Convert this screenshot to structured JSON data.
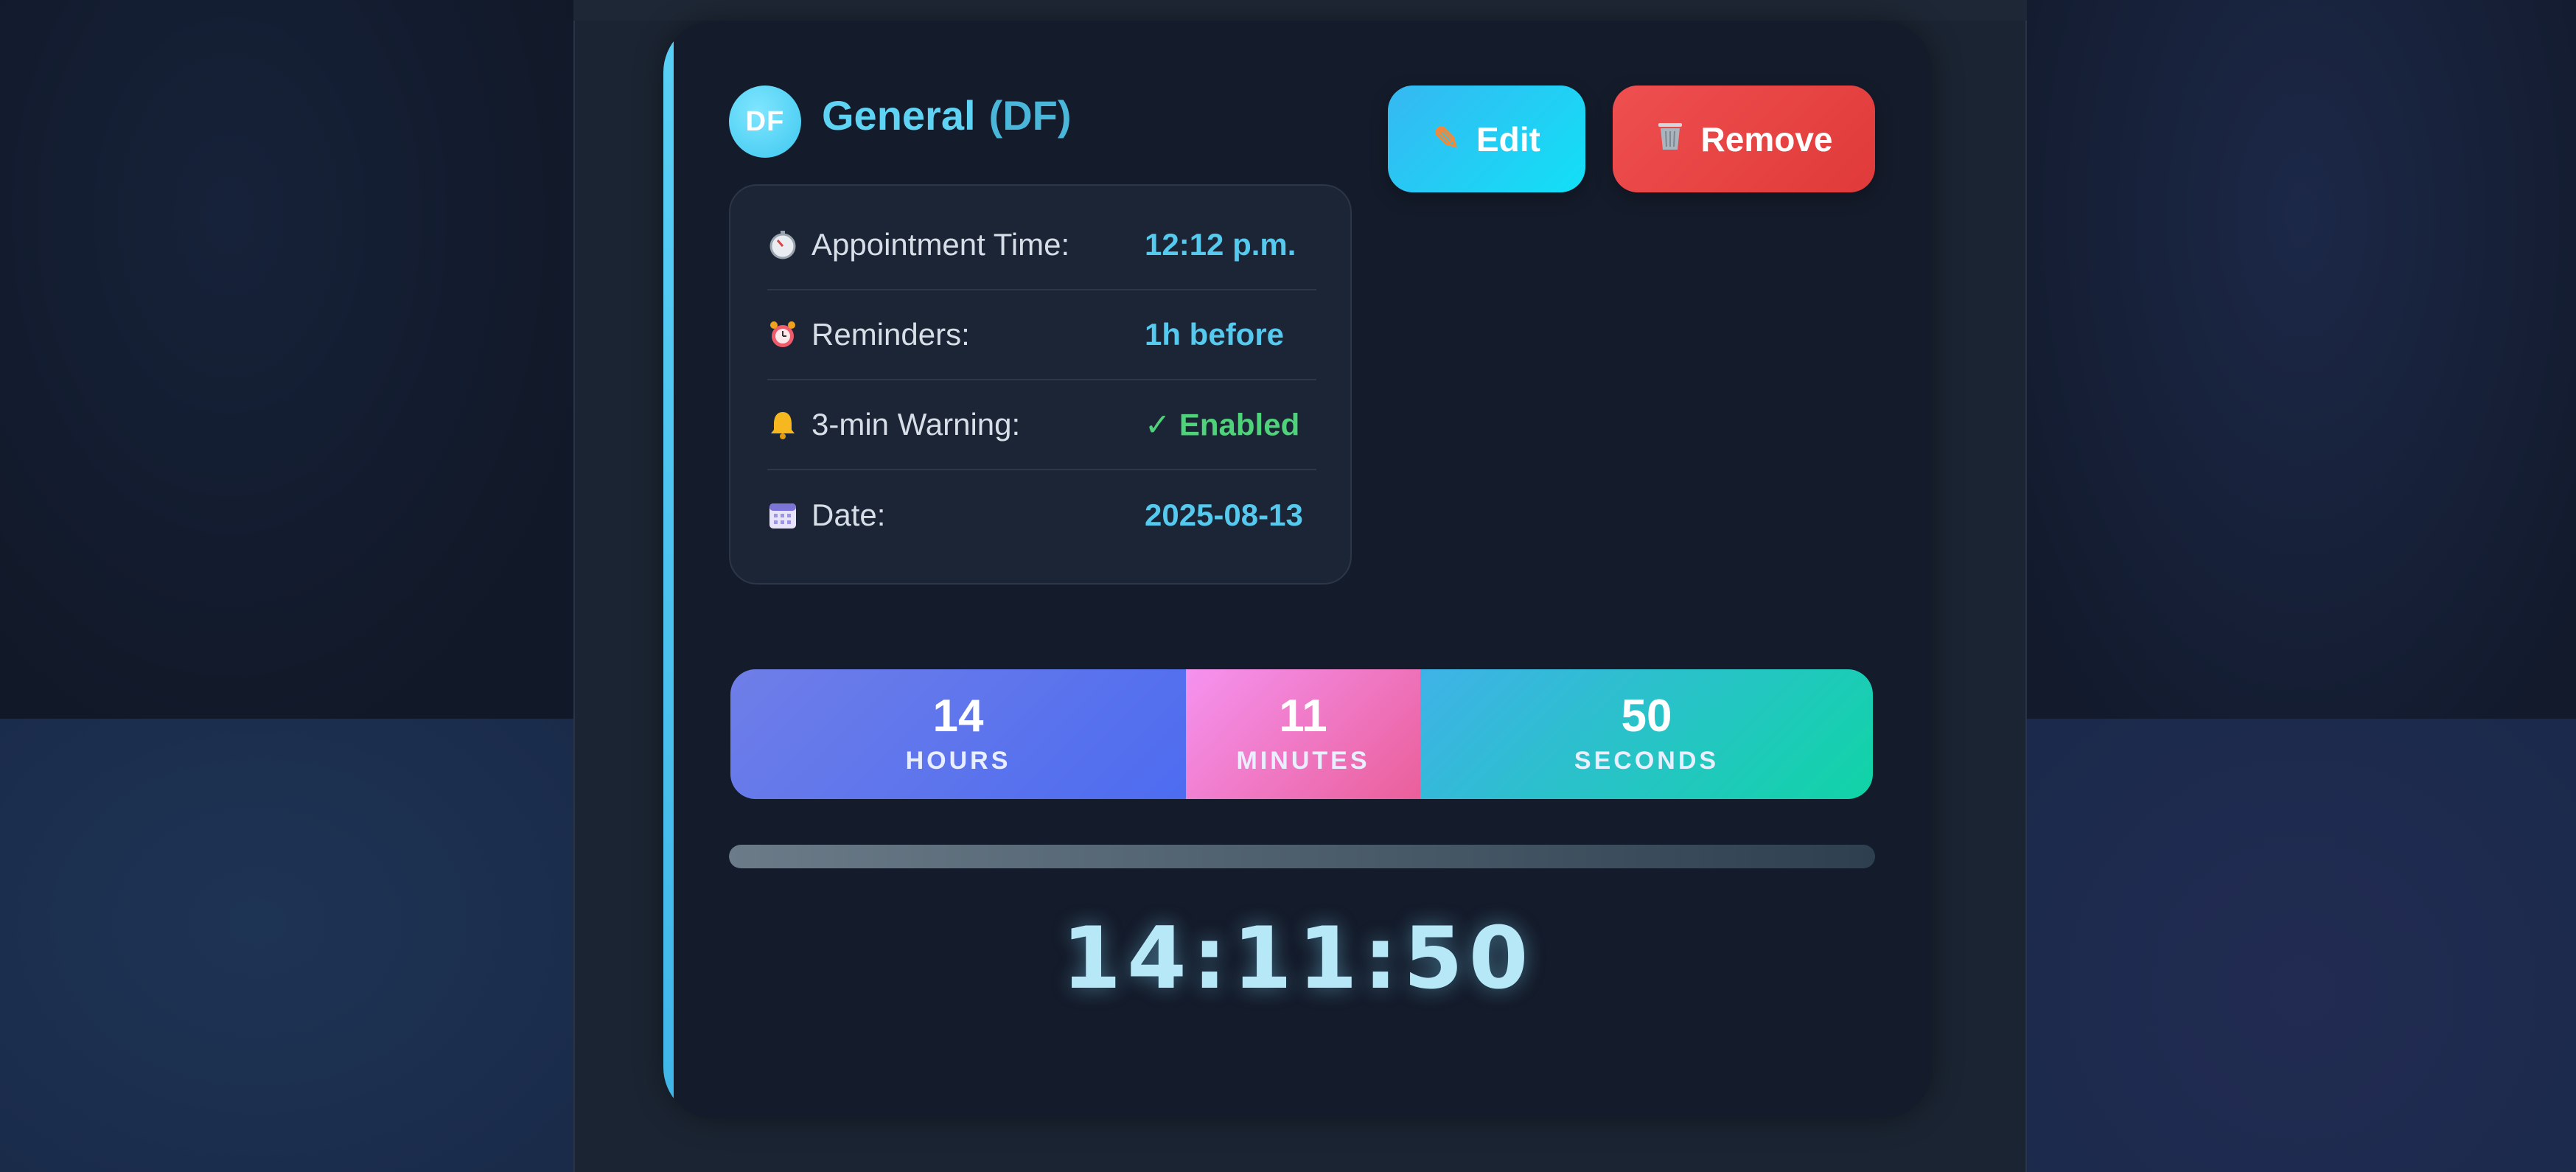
{
  "appointment": {
    "avatar_initials": "DF",
    "title": "General",
    "code": "(DF)"
  },
  "actions": {
    "edit_label": "Edit",
    "edit_icon": "pencil-icon",
    "remove_label": "Remove",
    "remove_icon": "wastebasket-icon"
  },
  "details": [
    {
      "icon": "stopwatch-icon",
      "label": "Appointment Time:",
      "value": "12:12 p.m."
    },
    {
      "icon": "alarm-clock-icon",
      "label": "Reminders:",
      "value": "1h before"
    },
    {
      "icon": "bell-icon",
      "label": "3-min Warning:",
      "value": "✓ Enabled"
    },
    {
      "icon": "calendar-icon",
      "label": "Date:",
      "value": "2025-08-13"
    }
  ],
  "countdown": {
    "hours": {
      "value": "14",
      "unit": "HOURS"
    },
    "minutes": {
      "value": "11",
      "unit": "MINUTES"
    },
    "seconds": {
      "value": "50",
      "unit": "SECONDS"
    }
  },
  "progress": {
    "fraction": 0.0
  },
  "clock": "14:11:50",
  "colors": {
    "accent": "#5fd3f3",
    "edit": "#12e0f6",
    "remove": "#e03a3a",
    "enabled": "#4ed27a",
    "hours": "#4d6cf0",
    "minutes": "#ea5f9a",
    "seconds": "#10d4a6"
  }
}
